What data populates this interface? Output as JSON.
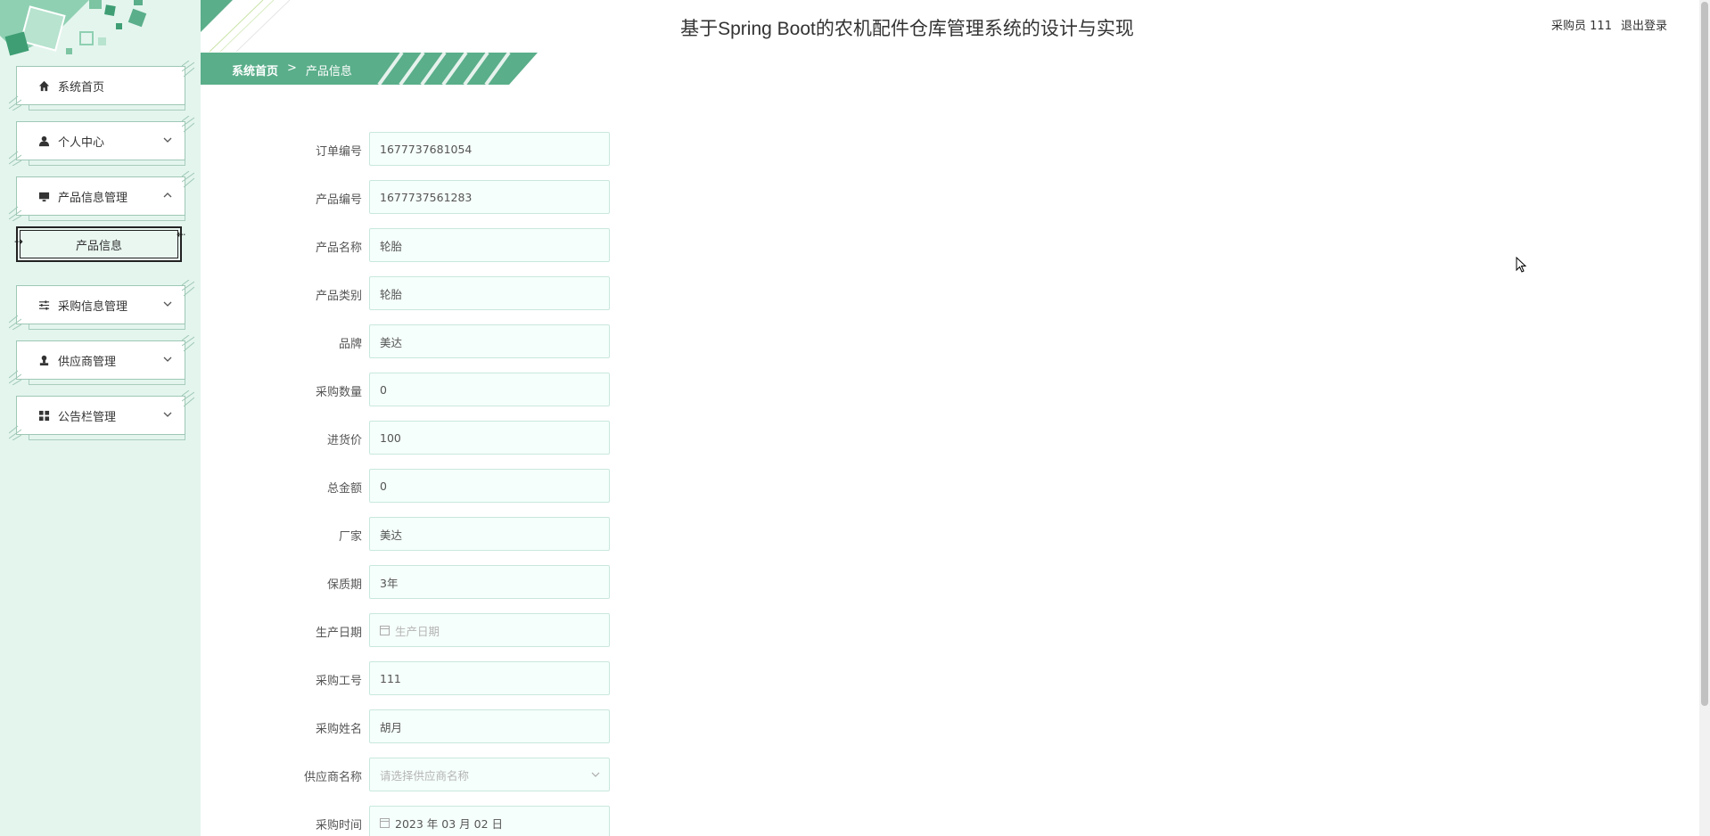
{
  "header": {
    "title": "基于Spring Boot的农机配件仓库管理系统的设计与实现",
    "user_label": "采购员 111",
    "logout_label": "退出登录"
  },
  "breadcrumb": {
    "home": "系统首页",
    "separator": ">",
    "current": "产品信息"
  },
  "sidebar": {
    "items": [
      {
        "label": "系统首页",
        "icon": "home-icon",
        "has_chevron": false
      },
      {
        "label": "个人中心",
        "icon": "user-icon",
        "has_chevron": true,
        "chevron": "down"
      },
      {
        "label": "产品信息管理",
        "icon": "monitor-icon",
        "has_chevron": true,
        "chevron": "up"
      },
      {
        "label": "采购信息管理",
        "icon": "sliders-icon",
        "has_chevron": true,
        "chevron": "down"
      },
      {
        "label": "供应商管理",
        "icon": "stamp-icon",
        "has_chevron": true,
        "chevron": "down"
      },
      {
        "label": "公告栏管理",
        "icon": "grid-icon",
        "has_chevron": true,
        "chevron": "down"
      }
    ],
    "sub_item": {
      "label": "产品信息"
    }
  },
  "form": {
    "fields": [
      {
        "label": "订单编号",
        "value": "1677737681054"
      },
      {
        "label": "产品编号",
        "value": "1677737561283"
      },
      {
        "label": "产品名称",
        "value": "轮胎"
      },
      {
        "label": "产品类别",
        "value": "轮胎"
      },
      {
        "label": "品牌",
        "value": "美达"
      },
      {
        "label": "采购数量",
        "value": "0"
      },
      {
        "label": "进货价",
        "value": "100"
      },
      {
        "label": "总金额",
        "value": "0"
      },
      {
        "label": "厂家",
        "value": "美达"
      },
      {
        "label": "保质期",
        "value": "3年"
      },
      {
        "label": "生产日期",
        "placeholder": "生产日期",
        "type": "date"
      },
      {
        "label": "采购工号",
        "value": "111"
      },
      {
        "label": "采购姓名",
        "value": "胡月"
      },
      {
        "label": "供应商名称",
        "placeholder": "请选择供应商名称",
        "type": "select"
      },
      {
        "label": "采购时间",
        "value": "2023 年 03 月 02 日",
        "type": "date"
      }
    ]
  },
  "colors": {
    "sidebar_bg": "#e4f5ee",
    "accent_green": "#5aae8a",
    "input_border": "#c9e8dd",
    "input_bg": "#f5fffb"
  }
}
